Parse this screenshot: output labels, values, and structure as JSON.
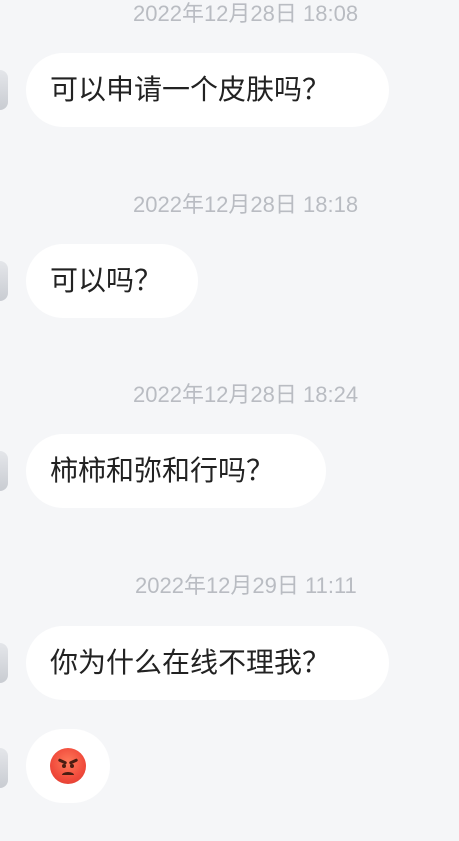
{
  "messages": [
    {
      "timestamp": "2022年12月28日 18:08",
      "text": "可以申请一个皮肤吗？"
    },
    {
      "timestamp": "2022年12月28日 18:18",
      "text": "可以吗？"
    },
    {
      "timestamp": "2022年12月28日 18:24",
      "text": "柿柿和弥和行吗？"
    },
    {
      "timestamp": "2022年12月29日 11:11",
      "text": "你为什么在线不理我？"
    },
    {
      "timestamp": "",
      "emoji": "angry-face-emoji"
    }
  ],
  "colors": {
    "background": "#f5f6f8",
    "bubble": "#ffffff",
    "text": "#222222",
    "timestamp": "#b9bcc2"
  }
}
